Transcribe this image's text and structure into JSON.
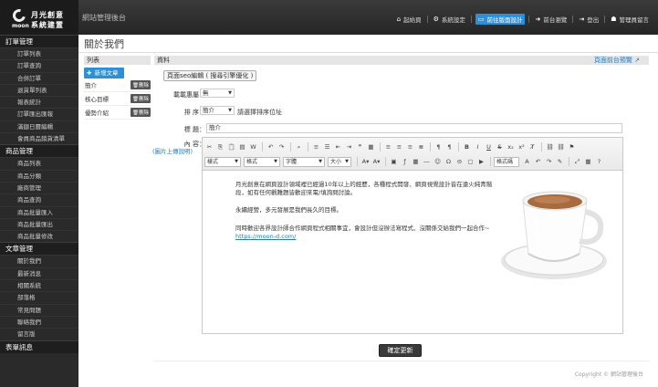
{
  "brand": {
    "logo_cn_line1": "月光創意",
    "logo_cn_line2": "系統建置",
    "logo_en": "moon"
  },
  "header": {
    "system_title": "網站管理後台",
    "nav": [
      {
        "icon": "home-icon",
        "label": "起始頁"
      },
      {
        "icon": "gear-icon",
        "label": "系統設定"
      },
      {
        "icon": "monitor-icon",
        "label": "前往版面設計",
        "active": true
      },
      {
        "icon": "arrow-right-icon",
        "label": "前台瀏覽"
      },
      {
        "icon": "logout-icon",
        "label": "登出"
      },
      {
        "icon": "user-icon",
        "label": "管理員留言"
      }
    ]
  },
  "sidebar": {
    "sections": [
      {
        "title": "訂單管理",
        "items": [
          "訂單列表",
          "訂單查詢",
          "合併訂單",
          "退貨單列表",
          "報表統計",
          "訂單匯出匯報",
          "滿額日曆編輯",
          "會員商品銷貨清單"
        ]
      },
      {
        "title": "商品管理",
        "items": [
          "商品列表",
          "商品分類",
          "廠商管理",
          "商品查詢",
          "商品批量匯入",
          "商品批量匯出",
          "商品批量修改"
        ]
      },
      {
        "title": "文章管理",
        "items": [
          "關於我們",
          "最新消息",
          "相關系統",
          "部落格",
          "常見問題",
          "聯絡我們",
          "留言版"
        ]
      },
      {
        "title": "表單訊息",
        "items": []
      }
    ]
  },
  "page": {
    "title": "關於我們"
  },
  "list_panel": {
    "heading": "列表",
    "add_button": "新增文章",
    "delete_label": "刪除",
    "items": [
      "簡介",
      "核心目標",
      "優勢介紹"
    ]
  },
  "data_panel": {
    "heading": "資料",
    "preview_link": "頁面前台預覽",
    "seo_tab": "頁面seo編輯 ( 搜尋引擎優化 )",
    "fields": {
      "display_category_label": "載載惠屬：",
      "display_category_value": "無",
      "order_label": "排 序：",
      "order_value": "簡介",
      "order_hint": "請選擇排序位址",
      "title_label": "標 題：",
      "title_value": "簡介",
      "content_label": "內 容：",
      "image_upload_link": "(圖片上傳說明)"
    },
    "toolbar": {
      "format_select": "樣式",
      "style_select": "格式",
      "font_select": "字體",
      "size_select": "大小",
      "format_table": "格式碼"
    },
    "content": {
      "paragraph1_line1": "月光創意在網頁設計領域裡已經過10年以上的經歷，各種程式開發、網頁視覺設計皆在遠火純青階",
      "paragraph1_line2": "段，如有任何觀難題皆歡迎來電/填詢問討論。",
      "paragraph2": "永續經營，多元發展是我們長久的目標。",
      "paragraph3": "同時歡迎各界設計師合作網頁程式相關事宜，會設計但沒辦法寫程式、沒關係交給我們一起合作~",
      "link": "https://moon-d.com/"
    },
    "submit_button": "確定更新"
  },
  "footer": {
    "copyright": "Copyright © 網站管理後台"
  }
}
